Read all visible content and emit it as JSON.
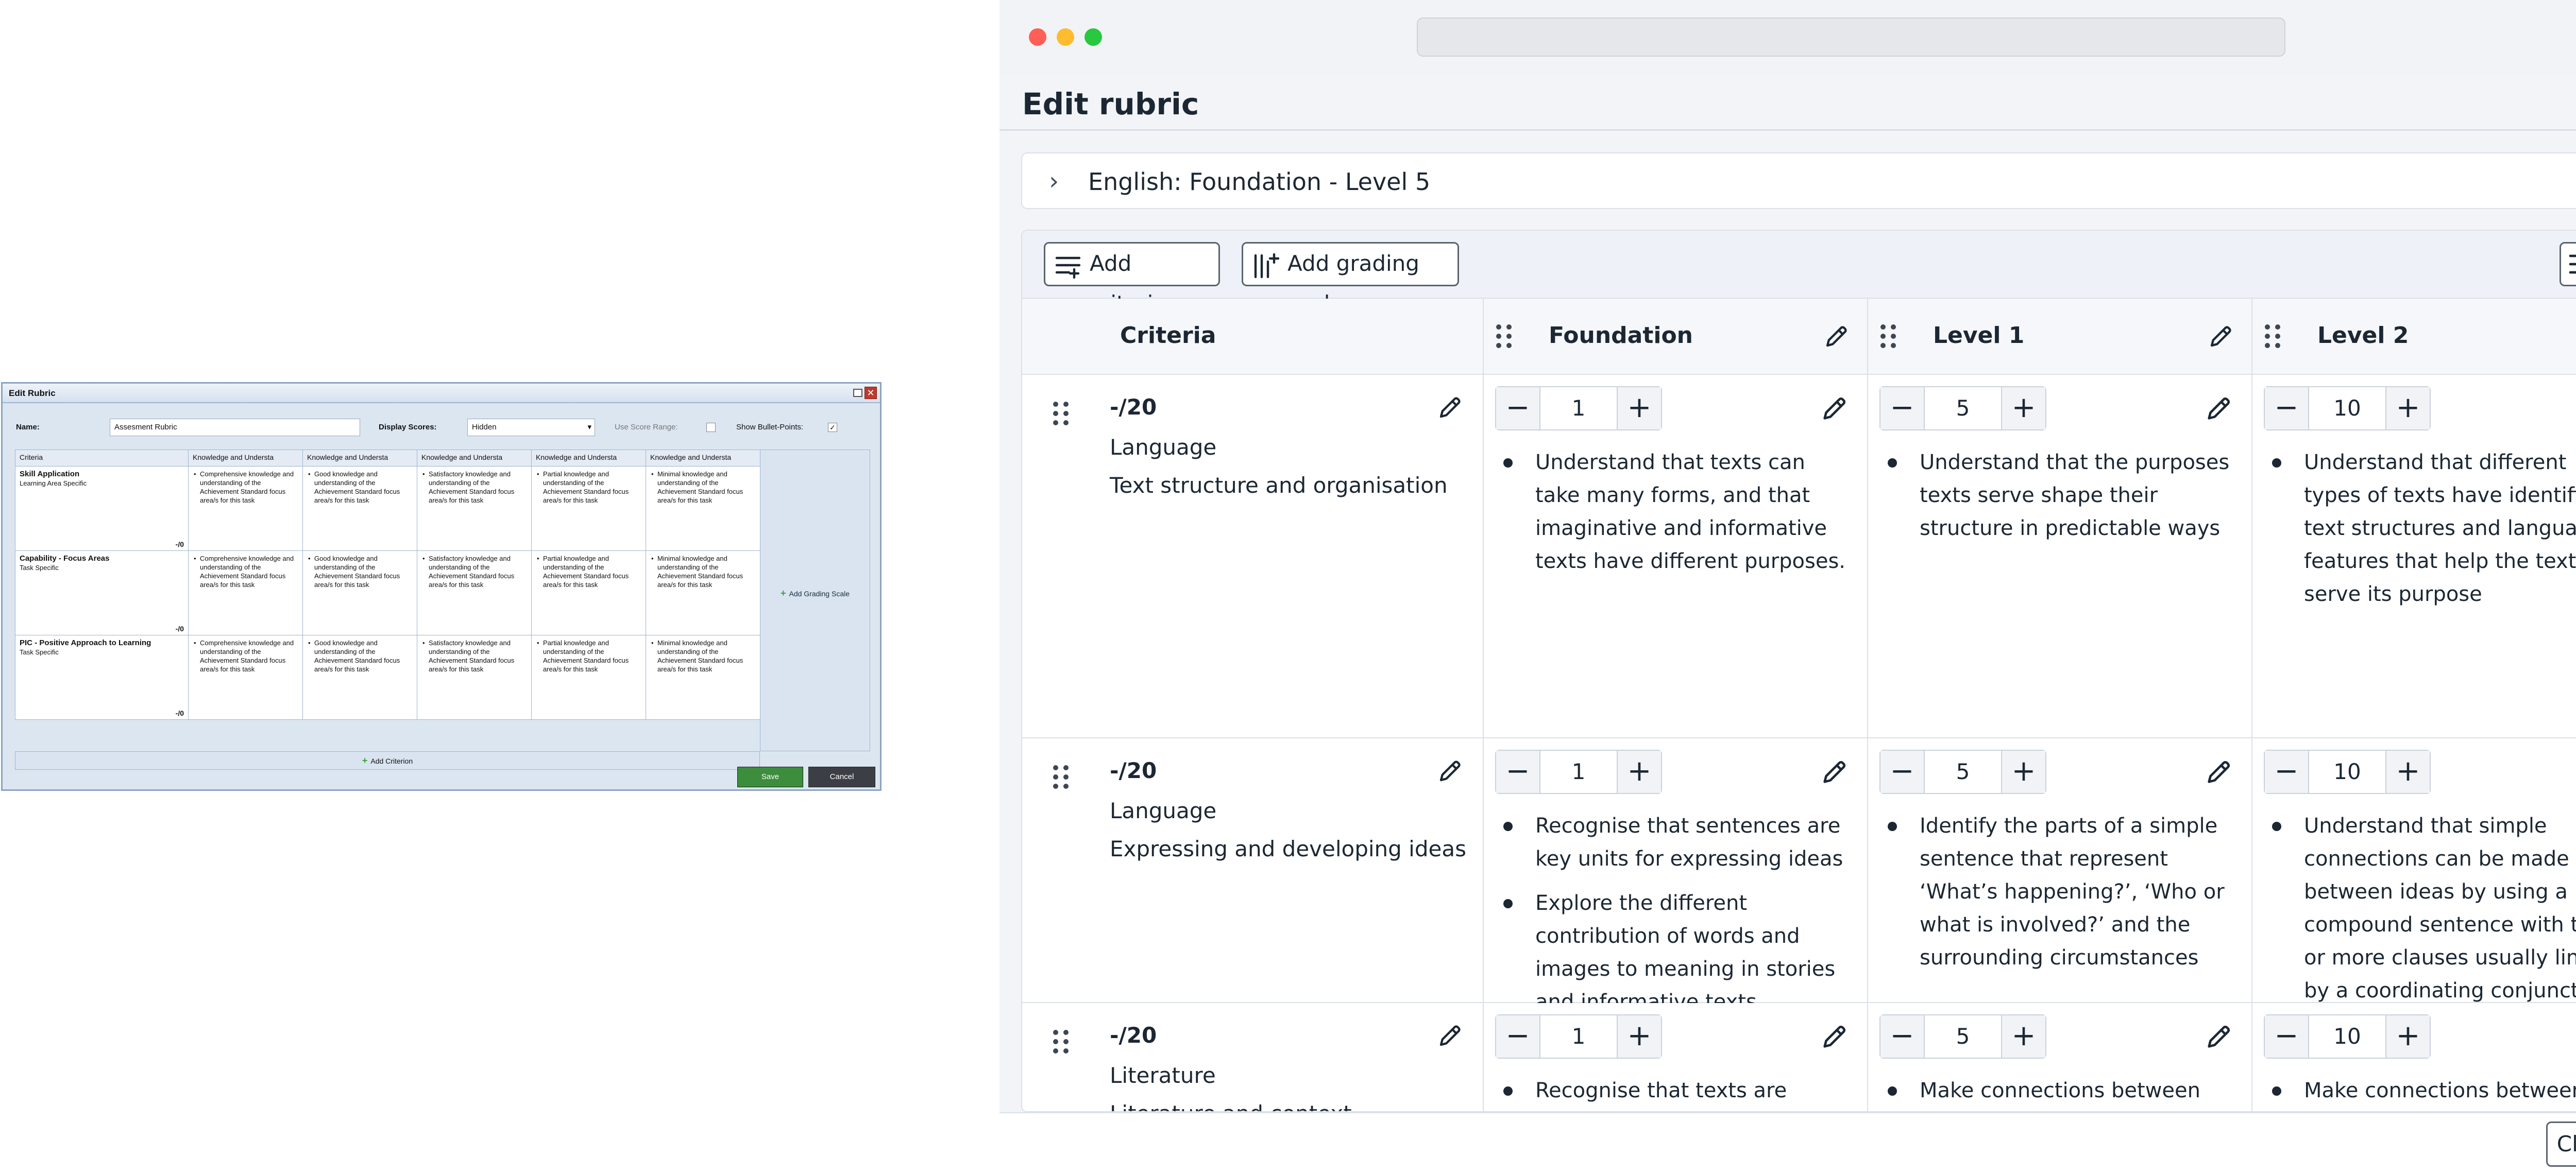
{
  "legacy_dialog": {
    "title": "Edit Rubric",
    "close_glyph": "✕",
    "name_label": "Name:",
    "name_value": "Assesment Rubric",
    "display_scores_label": "Display Scores:",
    "display_scores_value": "Hidden",
    "use_score_range_label": "Use Score Range:",
    "use_score_range_checked": false,
    "show_bullets_label": "Show Bullet-Points:",
    "show_bullets_checked": true,
    "check_glyph": "✓",
    "columns": [
      "Criteria",
      "Knowledge and Understa",
      "Knowledge and Understa",
      "Knowledge and Understa",
      "Knowledge and Understa",
      "Knowledge and Understa"
    ],
    "rows": [
      {
        "name": "Skill Application",
        "sub": "Learning Area Specific",
        "score": "-/0",
        "cells": [
          "Comprehensive knowledge and understanding of the Achievement Standard focus area/s for this task",
          "Good knowledge and understanding of the Achievement Standard focus area/s for this task",
          "Satisfactory knowledge and understanding of the Achievement Standard focus area/s for this task",
          "Partial knowledge and understanding of the Achievement Standard focus area/s for this task",
          "Minimal knowledge and understanding of the Achievement Standard focus area/s for this task"
        ]
      },
      {
        "name": "Capability - Focus Areas",
        "sub": "Task Specific",
        "score": "-/0",
        "cells": [
          "Comprehensive knowledge and understanding of the Achievement Standard focus area/s for this task",
          "Good knowledge and understanding of the Achievement Standard focus area/s for this task",
          "Satisfactory knowledge and understanding of the Achievement Standard focus area/s for this task",
          "Partial knowledge and understanding of the Achievement Standard focus area/s for this task",
          "Minimal knowledge and understanding of the Achievement Standard focus area/s for this task"
        ]
      },
      {
        "name": "PIC - Positive Approach to Learning",
        "sub": "Task Specific",
        "score": "-/0",
        "cells": [
          "Comprehensive knowledge and understanding of the Achievement Standard focus area/s for this task",
          "Good knowledge and understanding of the Achievement Standard focus area/s for this task",
          "Satisfactory knowledge and understanding of the Achievement Standard focus area/s for this task",
          "Partial knowledge and understanding of the Achievement Standard focus area/s for this task",
          "Minimal knowledge and understanding of the Achievement Standard focus area/s for this task"
        ]
      }
    ],
    "add_grading_scale": "Add Grading Scale",
    "add_criterion": "Add Criterion",
    "save_label": "Save",
    "cancel_label": "Cancel",
    "plus_glyph": "+"
  },
  "window": {
    "title": "Edit rubric",
    "close_glyph": "✕",
    "subject": "English: Foundation - Level 5",
    "chevron_glyph": "›",
    "toolbar": {
      "add_criterion": "Add criterion",
      "add_grading_scale": "Add grading scale"
    },
    "header": {
      "criteria": "Criteria",
      "levels": [
        "Foundation",
        "Level 1",
        "Level 2"
      ]
    },
    "stepper_minus": "−",
    "stepper_plus": "+",
    "rows": [
      {
        "score": "-/20",
        "name": "Language",
        "sub": "Text structure and organisation",
        "levels": [
          {
            "value": "1",
            "items": [
              "Understand that texts can take many forms, and that imaginative and informative texts have different purposes."
            ]
          },
          {
            "value": "5",
            "items": [
              "Understand that the purposes texts serve shape their structure in predictable ways"
            ]
          },
          {
            "value": "10",
            "items": [
              "Understand that different types of texts have identifiable text structures and language features that help the text serve its purpose"
            ]
          }
        ]
      },
      {
        "score": "-/20",
        "name": "Language",
        "sub": "Expressing and developing ideas",
        "levels": [
          {
            "value": "1",
            "items": [
              "Recognise that sentences are key units for expressing ideas",
              "Explore the different contribution of words and images to meaning in stories and informative texts"
            ]
          },
          {
            "value": "5",
            "items": [
              "Identify the parts of a simple sentence that represent ‘What’s happening?’, ‘Who or what is involved?’ and the surrounding circumstances"
            ]
          },
          {
            "value": "10",
            "items": [
              "Understand that simple connections can be made between ideas by using a compound sentence with two or more clauses usually linked by a coordinating conjunction"
            ]
          }
        ]
      },
      {
        "score": "-/20",
        "name": "Literature",
        "sub": "Literature and context",
        "levels": [
          {
            "value": "1",
            "items": [
              "Recognise that texts are created by authors who tell stories and"
            ]
          },
          {
            "value": "5",
            "items": [
              "Make connections between the ways different authors may"
            ]
          },
          {
            "value": "10",
            "items": [
              "Make connections between the ways different authors may"
            ]
          }
        ]
      }
    ],
    "close_button": "Close"
  }
}
